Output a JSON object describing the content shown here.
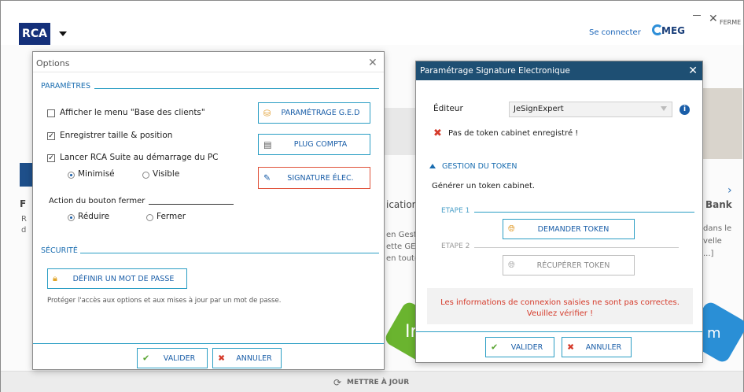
{
  "app": {
    "logo_text": "RCA",
    "connect_label": "Se connecter",
    "brand": "MEG",
    "window_close_label": "FERME",
    "update_label": "METTRE À JOUR"
  },
  "background": {
    "heading_left": "F",
    "heading_mid": "ication",
    "heading_right": "Bank",
    "mid_lines": [
      "en Gesti",
      "ette GEI",
      "en toute"
    ],
    "right_lines": [
      "dans le",
      "velle",
      "...]"
    ],
    "left_letters": [
      "R",
      "d"
    ],
    "hex_mid_text": "Ir",
    "hex_right_text": "m"
  },
  "options": {
    "title": "Options",
    "section_params": "PARAMÈTRES",
    "cb_base_clients": "Afficher le menu \"Base des clients\"",
    "cb_taille": "Enregistrer taille & position",
    "cb_lancer": "Lancer RCA Suite au démarrage du PC",
    "radio_minimise": "Minimisé",
    "radio_visible": "Visible",
    "action_label": "Action du bouton fermer",
    "radio_reduire": "Réduire",
    "radio_fermer": "Fermer",
    "btn_ged": "PARAMÉTRAGE G.E.D",
    "btn_plug": "PLUG COMPTA",
    "btn_signature": "SIGNATURE ÉLEC.",
    "section_securite": "SÉCURITÉ",
    "btn_password": "DÉFINIR UN MOT DE PASSE",
    "password_hint": "Protéger l'accès aux options et aux mises à jour par un mot de passe.",
    "btn_valider": "VALIDER",
    "btn_annuler": "ANNULER"
  },
  "signature": {
    "title": "Paramétrage Signature Electronique",
    "editor_label": "Éditeur",
    "editor_value": "JeSignExpert",
    "no_token_msg": "Pas de token cabinet enregistré !",
    "section_token": "GESTION DU TOKEN",
    "generate_label": "Générer un token cabinet.",
    "step1": "ETAPE 1",
    "btn_demander": "DEMANDER TOKEN",
    "step2": "ETAPE 2",
    "btn_recuperer": "RÉCUPÉRER TOKEN",
    "error_line1": "Les informations de connexion saisies ne sont pas correctes.",
    "error_line2": "Veuillez vérifier !",
    "btn_valider": "VALIDER",
    "btn_annuler": "ANNULER"
  },
  "colors": {
    "accent": "#2b9ec4",
    "error": "#d53b2b",
    "title_bar": "#1e4f73"
  }
}
